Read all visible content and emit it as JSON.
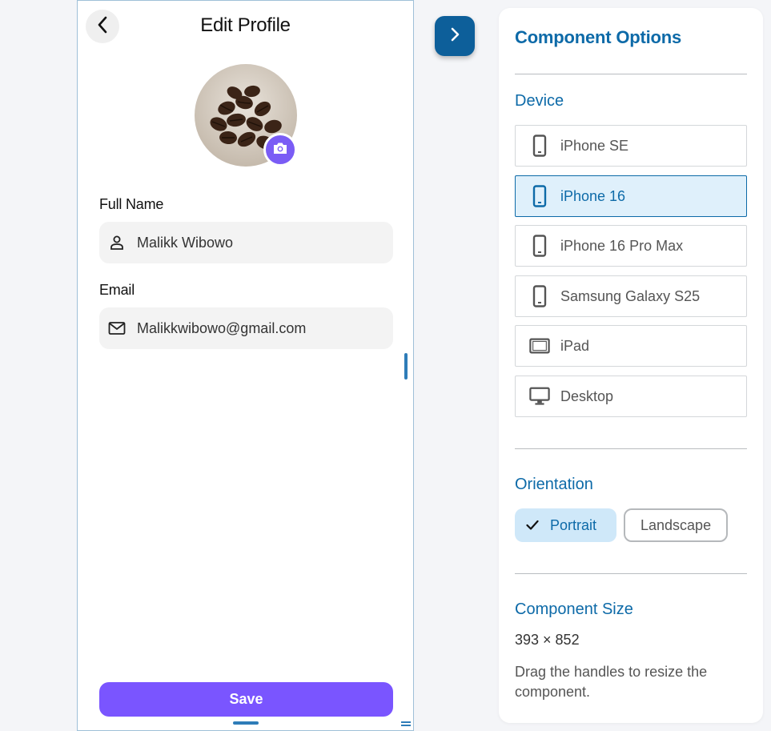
{
  "phone": {
    "title": "Edit Profile",
    "fields": [
      {
        "label": "Full Name",
        "value": "Malikk Wibowo",
        "icon": "person-icon"
      },
      {
        "label": "Email",
        "value": "Malikkwibowo@gmail.com",
        "icon": "mail-icon"
      }
    ],
    "save_label": "Save"
  },
  "panel": {
    "title": "Component Options",
    "device_section": "Device",
    "devices": [
      {
        "label": "iPhone SE",
        "icon": "phone-icon",
        "selected": false
      },
      {
        "label": "iPhone 16",
        "icon": "phone-icon",
        "selected": true
      },
      {
        "label": "iPhone 16 Pro Max",
        "icon": "phone-icon",
        "selected": false
      },
      {
        "label": "Samsung Galaxy S25",
        "icon": "phone-icon",
        "selected": false
      },
      {
        "label": "iPad",
        "icon": "tablet-icon",
        "selected": false
      },
      {
        "label": "Desktop",
        "icon": "desktop-icon",
        "selected": false
      }
    ],
    "orientation_section": "Orientation",
    "orientation": {
      "portrait": "Portrait",
      "landscape": "Landscape",
      "selected": "Portrait"
    },
    "size_section": "Component Size",
    "size_value": "393 × 852",
    "size_hint": "Drag the handles to resize the component."
  },
  "colors": {
    "accent": "#0d6aa8",
    "primary_button": "#7a55ff",
    "camera_badge": "#7a5cf5"
  }
}
